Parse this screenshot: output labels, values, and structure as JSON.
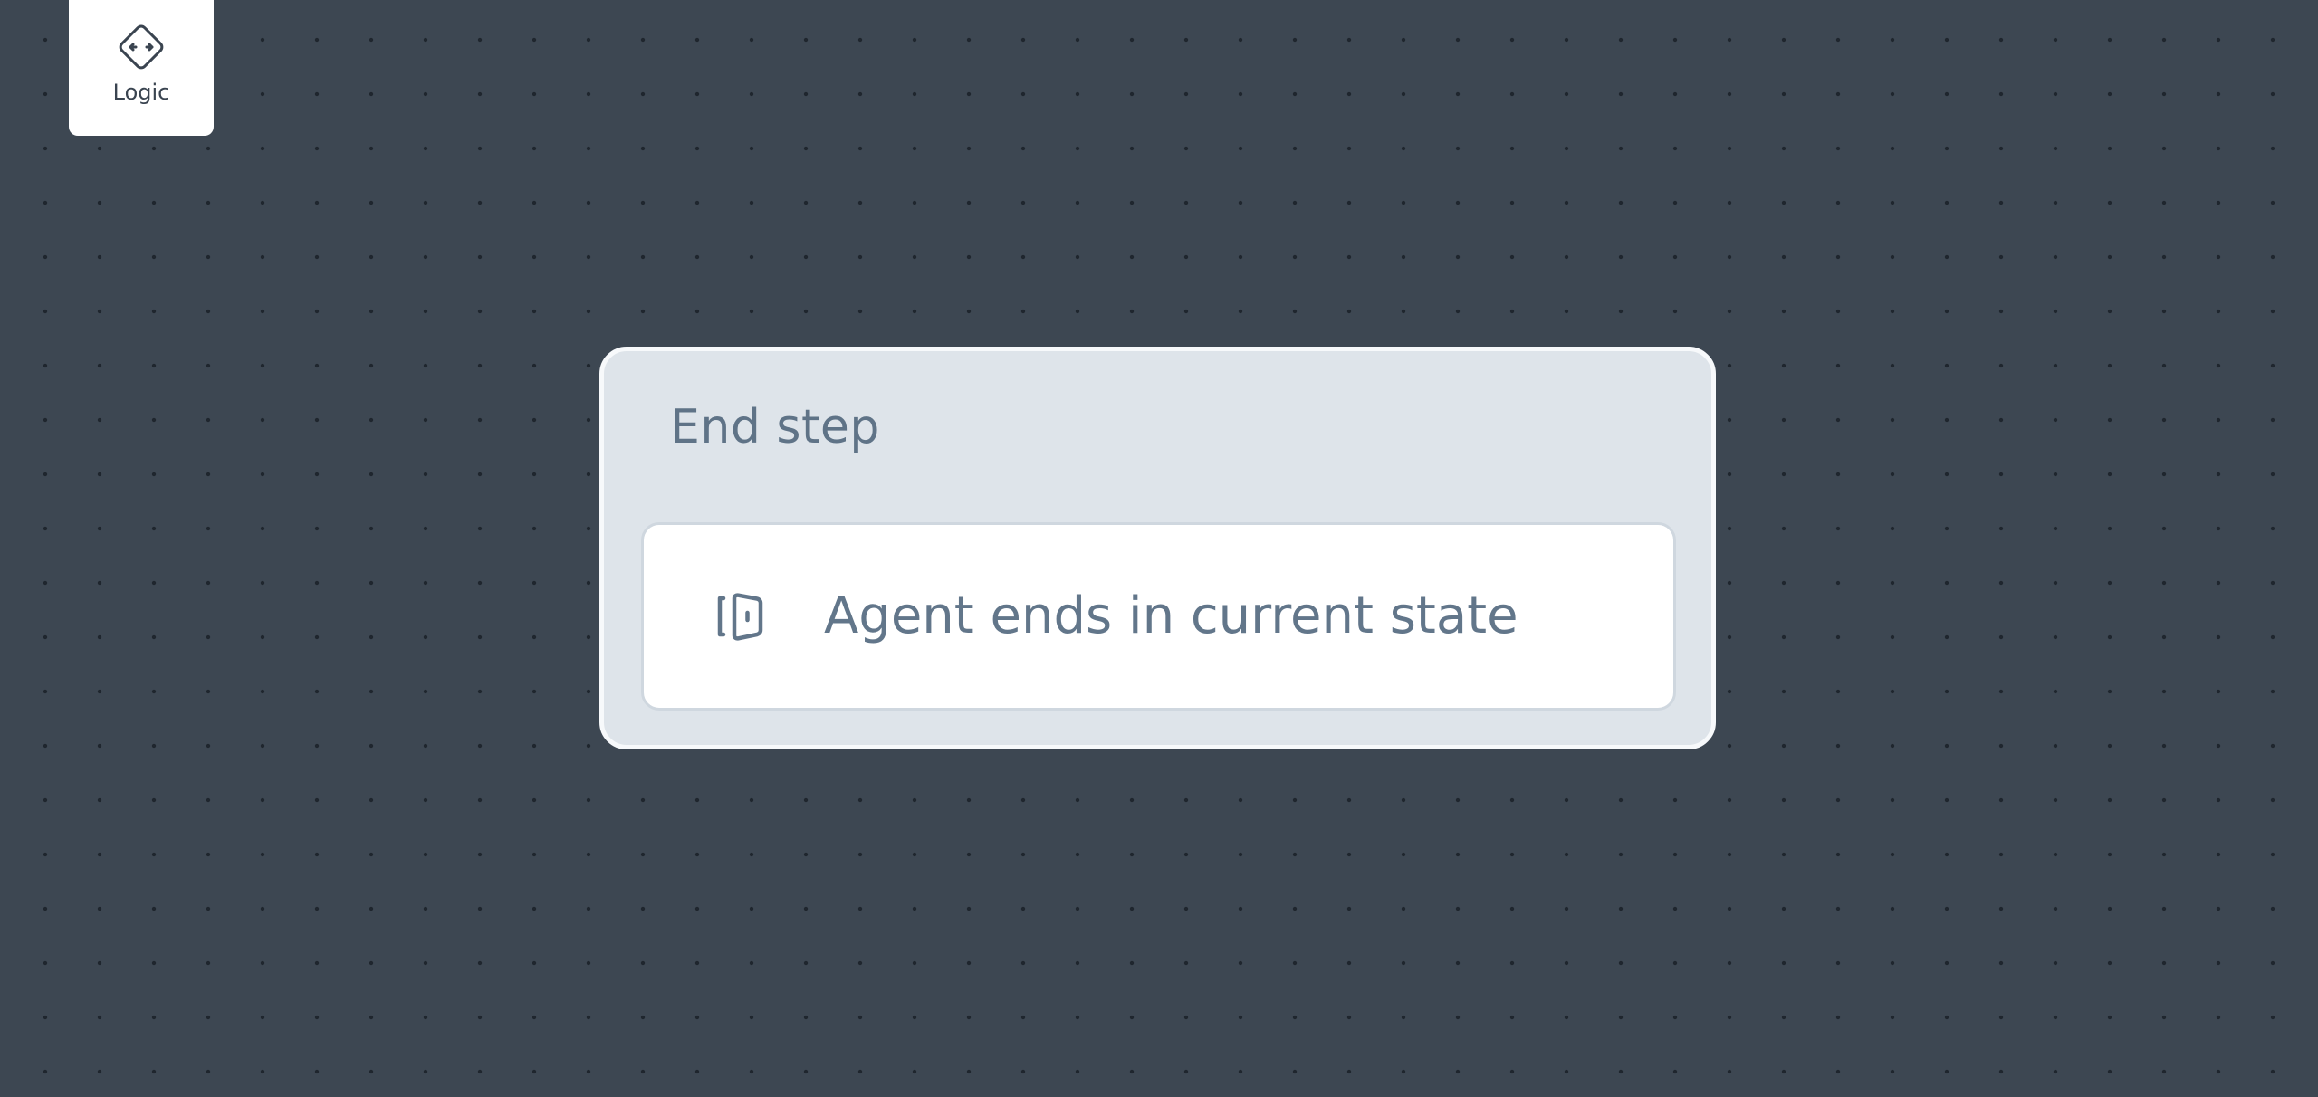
{
  "toolbar": {
    "logic": {
      "label": "Logic",
      "icon": "diamond-arrows-icon"
    }
  },
  "canvas": {
    "background": "dotted-grid",
    "node": {
      "title": "End step",
      "action": {
        "label": "Agent ends in current state",
        "icon": "door-icon"
      }
    }
  },
  "colors": {
    "canvas_background": "#3d4752",
    "grid_dot": "#1f262e",
    "node_background": "#dee4ea",
    "node_border": "#f7f9fb",
    "text_muted": "#5f7387",
    "card_background": "#ffffff"
  }
}
